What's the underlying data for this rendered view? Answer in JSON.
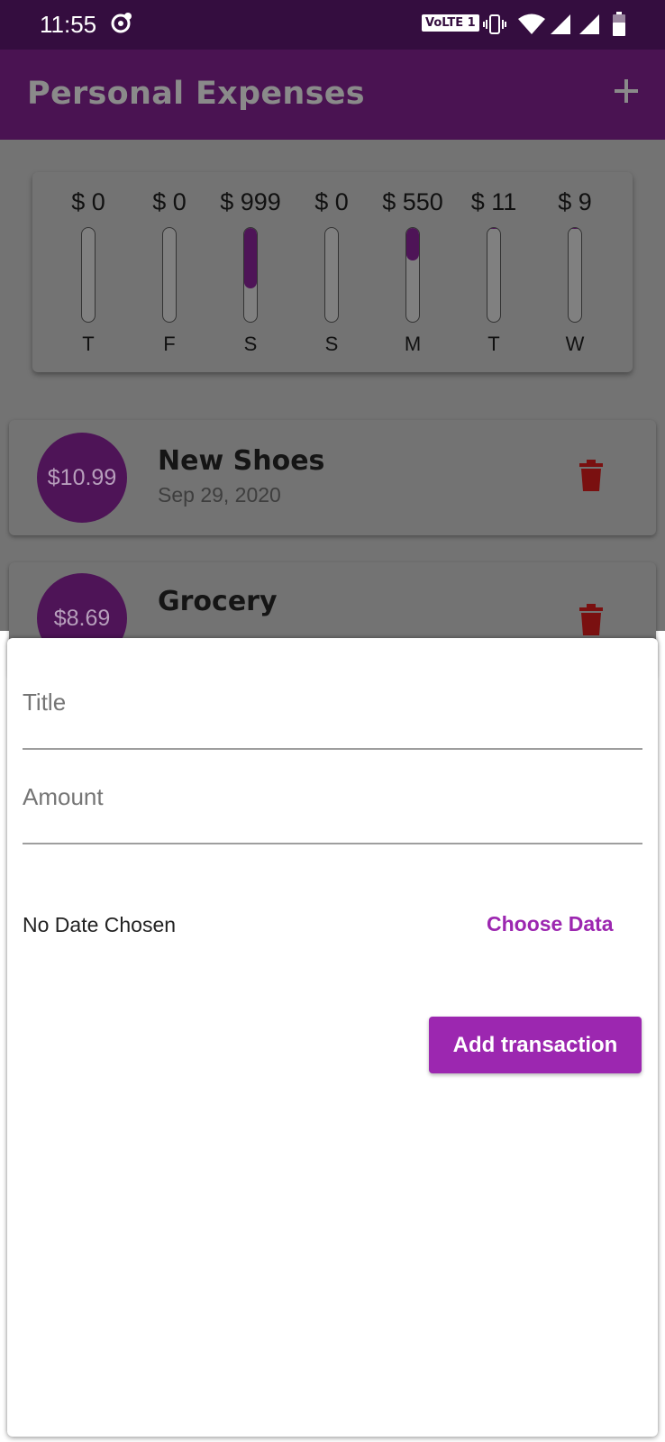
{
  "status_bar": {
    "time": "11:55",
    "network_badge": "VoLTE 1",
    "icons": [
      "sync-icon",
      "vibrate-icon",
      "wifi-icon",
      "signal-icon",
      "signal-icon",
      "battery-icon"
    ]
  },
  "app_bar": {
    "title": "Personal Expenses",
    "add_icon": "plus-icon",
    "background_color": "#4a1352"
  },
  "chart": {
    "bars": [
      {
        "amount": "$ 0",
        "day": "T",
        "fraction": 0
      },
      {
        "amount": "$ 0",
        "day": "F",
        "fraction": 0
      },
      {
        "amount": "$ 999",
        "day": "S",
        "fraction": 0.64
      },
      {
        "amount": "$ 0",
        "day": "S",
        "fraction": 0
      },
      {
        "amount": "$ 550",
        "day": "M",
        "fraction": 0.35
      },
      {
        "amount": "$ 11",
        "day": "T",
        "fraction": 0.01
      },
      {
        "amount": "$ 9",
        "day": "W",
        "fraction": 0.01
      }
    ],
    "fill_color": "#4e1457"
  },
  "transactions": [
    {
      "amount": "$10.99",
      "title": "New Shoes",
      "date": "Sep 29, 2020",
      "delete_icon": "trash-icon"
    },
    {
      "amount": "$8.69",
      "title": "Grocery",
      "date": "",
      "delete_icon": "trash-icon"
    }
  ],
  "form": {
    "title_placeholder": "Title",
    "amount_placeholder": "Amount",
    "no_date_text": "No Date Chosen",
    "choose_date_label": "Choose Data",
    "submit_label": "Add transaction",
    "accent_color": "#9c27b0"
  }
}
